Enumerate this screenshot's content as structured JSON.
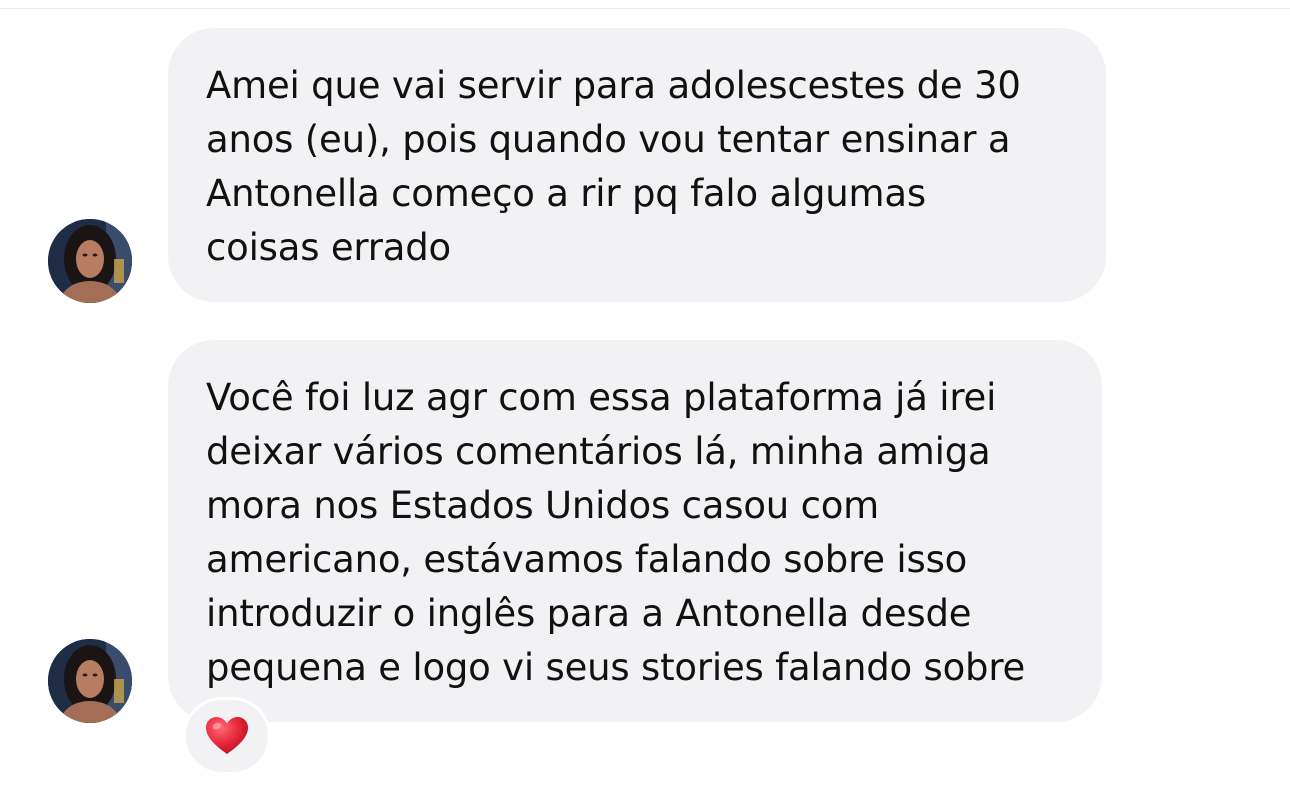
{
  "messages": [
    {
      "sender_avatar": "user-avatar",
      "lines": [
        "Amei que vai servir para adolescestes de 30",
        "anos (eu), pois quando vou tentar ensinar a",
        "Antonella começo a rir pq falo algumas",
        "coisas errado"
      ]
    },
    {
      "sender_avatar": "user-avatar",
      "lines": [
        "Você foi luz agr com essa plataforma já irei",
        "deixar vários comentários lá, minha amiga",
        "mora nos Estados Unidos casou com",
        "americano, estávamos falando sobre isso",
        "introduzir o inglês para a Antonella desde",
        "pequena e logo vi seus stories falando sobre"
      ],
      "reaction": "red-heart-icon"
    }
  ],
  "colors": {
    "bubble_background": "#f2f2f4",
    "text": "#111111",
    "reaction_heart": "#e0243a"
  }
}
